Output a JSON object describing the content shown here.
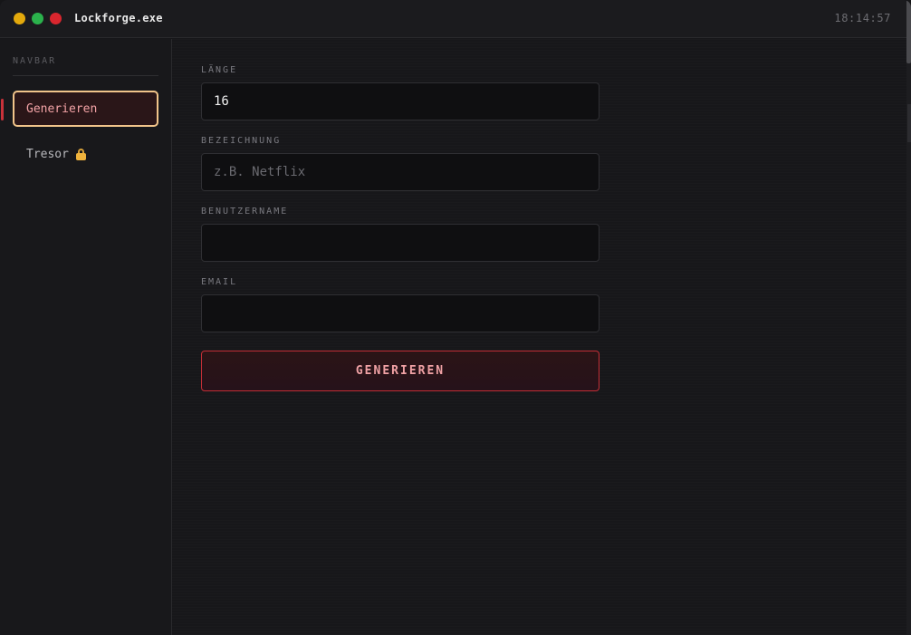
{
  "window": {
    "title": "Lockforge.exe",
    "clock": "18:14:57",
    "controls": [
      "minimize",
      "maximize",
      "close"
    ]
  },
  "sidebar": {
    "heading": "NAVBAR",
    "items": [
      {
        "label": "Generieren",
        "active": true
      },
      {
        "label": "Tresor",
        "icon": "lock-icon",
        "active": false
      }
    ]
  },
  "form": {
    "length": {
      "label": "LÄNGE",
      "value": "16",
      "placeholder": ""
    },
    "name": {
      "label": "BEZEICHNUNG",
      "value": "",
      "placeholder": "z.B. Netflix"
    },
    "username": {
      "label": "BENUTZERNAME",
      "value": "",
      "placeholder": ""
    },
    "email": {
      "label": "EMAIL",
      "value": "",
      "placeholder": ""
    },
    "submit_label": "GENERIEREN"
  },
  "colors": {
    "accent": "#c8323a",
    "active_border": "#f1c48a",
    "background": "#17171a"
  }
}
